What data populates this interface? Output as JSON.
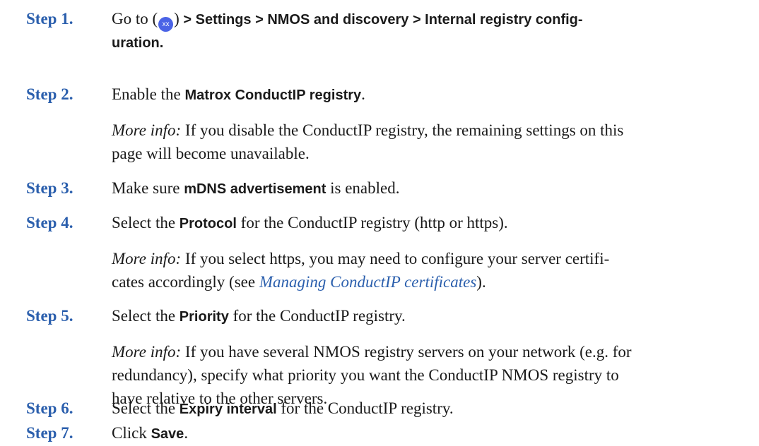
{
  "steps": [
    {
      "label": "Step 1.",
      "text_go_to": "Go to (",
      "icon_text": "xx",
      "text_close_paren": ")",
      "path_line1": " > Settings > NMOS and discovery > Internal registry config-",
      "path_line2": "uration."
    },
    {
      "label": "Step 2.",
      "text_before": "Enable the ",
      "ui_text": "Matrox ConductIP registry",
      "text_after": ".",
      "more_label": "More info:",
      "more_line1": " If you disable the ConductIP registry, the remaining settings on this",
      "more_line2": "page will become unavailable."
    },
    {
      "label": "Step 3.",
      "text_before": "Make sure ",
      "ui_text": "mDNS advertisement",
      "text_after": " is enabled."
    },
    {
      "label": "Step 4.",
      "text_before": "Select the ",
      "ui_text": "Protocol",
      "text_after": " for the ConductIP registry (http or https).",
      "more_label": "More info:",
      "more_line1": " If you select https, you may need to configure your server certifi-",
      "more_line2_before": "cates accordingly (see ",
      "more_link": "Managing ConductIP certificates",
      "more_line2_after": ")."
    },
    {
      "label": "Step 5.",
      "text_before": "Select the ",
      "ui_text": "Priority",
      "text_after": " for the ConductIP registry.",
      "more_label": "More info:",
      "more_line1": " If you have several NMOS registry servers on your network (e.g. for",
      "more_line2": "redundancy), specify what priority you want the ConductIP NMOS registry to",
      "more_line3": "have relative to the other servers."
    },
    {
      "label": "Step 6.",
      "text_before": "Select the ",
      "ui_text": "Expiry interval",
      "text_after": " for the ConductIP registry."
    },
    {
      "label": "Step 7.",
      "text_before": "Click ",
      "ui_text": "Save",
      "text_after": "."
    }
  ],
  "colors": {
    "step_label": "#2b5fad",
    "link": "#2b5fad",
    "icon_bg": "#4a63e6",
    "text": "#1a1a1a"
  },
  "icons": {
    "step1_icon": "xx-menu-icon"
  }
}
